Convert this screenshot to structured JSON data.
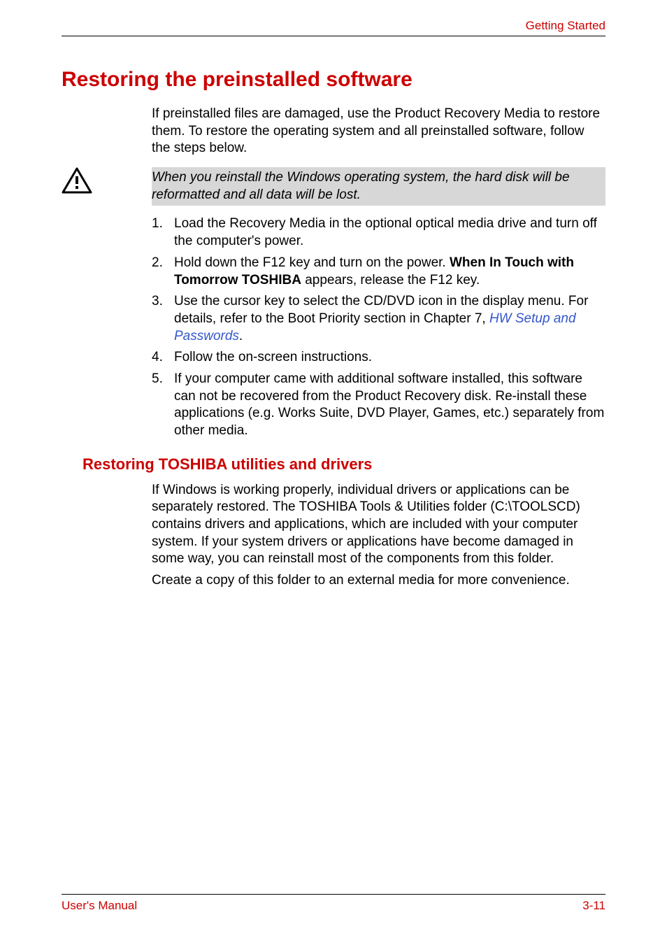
{
  "header": {
    "section_name": "Getting Started"
  },
  "section": {
    "title": "Restoring the preinstalled software",
    "intro": "If preinstalled files are damaged, use the Product Recovery Media to restore them. To restore the operating system and all preinstalled software, follow the steps below."
  },
  "caution": {
    "text": "When you reinstall the Windows operating system, the hard disk will be reformatted and all data will be lost."
  },
  "steps": {
    "items": [
      {
        "num": "1.",
        "text": "Load the Recovery Media in the optional optical media drive and turn off the computer's power."
      },
      {
        "num": "2.",
        "pre": "Hold down the F12 key and turn on the power. ",
        "bold": "When In Touch with Tomorrow TOSHIBA",
        "post": " appears, release the F12 key."
      },
      {
        "num": "3.",
        "pre": "Use the cursor key to select the CD/DVD icon in the display menu. For details, refer to the Boot Priority section in Chapter 7, ",
        "link": "HW Setup and Passwords",
        "post": "."
      },
      {
        "num": "4.",
        "text": "Follow the on-screen instructions."
      },
      {
        "num": "5.",
        "text": "If your computer came with additional software installed, this software can not be recovered from the Product Recovery disk. Re-install these applications (e.g. Works Suite, DVD Player, Games, etc.) separately from other media."
      }
    ]
  },
  "subsection": {
    "title": "Restoring TOSHIBA utilities and drivers",
    "para1": "If Windows is working properly, individual drivers or applications can be separately restored. The TOSHIBA Tools & Utilities folder (C:\\TOOLSCD) contains drivers and applications, which are included with your computer system. If your system drivers or applications have become damaged in some way, you can reinstall most of the components from this folder.",
    "para2": "Create a copy of this folder to an external media for more convenience."
  },
  "footer": {
    "left": "User's Manual",
    "right": "3-11"
  }
}
